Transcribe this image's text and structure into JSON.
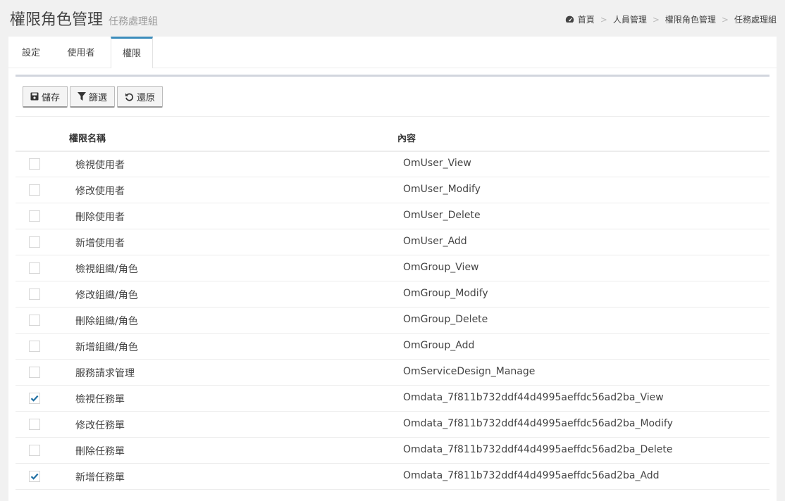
{
  "header": {
    "title": "權限角色管理",
    "subtitle": "任務處理組"
  },
  "breadcrumb": {
    "items": [
      "首頁",
      "人員管理",
      "權限角色管理",
      "任務處理組"
    ],
    "separator": ">",
    "home_icon": "dashboard-icon"
  },
  "tabs": [
    {
      "label": "設定"
    },
    {
      "label": "使用者"
    },
    {
      "label": "權限"
    }
  ],
  "active_tab": "權限",
  "toolbar": {
    "save_label": "儲存",
    "filter_label": "篩選",
    "reset_label": "還原"
  },
  "table": {
    "columns": {
      "name": "權限名稱",
      "content": "內容"
    },
    "rows": [
      {
        "name": "檢視使用者",
        "content": "OmUser_View",
        "checked": false
      },
      {
        "name": "修改使用者",
        "content": "OmUser_Modify",
        "checked": false
      },
      {
        "name": "刪除使用者",
        "content": "OmUser_Delete",
        "checked": false
      },
      {
        "name": "新增使用者",
        "content": "OmUser_Add",
        "checked": false
      },
      {
        "name": "檢視組織/角色",
        "content": "OmGroup_View",
        "checked": false
      },
      {
        "name": "修改組織/角色",
        "content": "OmGroup_Modify",
        "checked": false
      },
      {
        "name": "刪除組織/角色",
        "content": "OmGroup_Delete",
        "checked": false
      },
      {
        "name": "新增組織/角色",
        "content": "OmGroup_Add",
        "checked": false
      },
      {
        "name": "服務請求管理",
        "content": "OmServiceDesign_Manage",
        "checked": false
      },
      {
        "name": "檢視任務單",
        "content": "Omdata_7f811b732ddf44d4995aeffdc56ad2ba_View",
        "checked": true
      },
      {
        "name": "修改任務單",
        "content": "Omdata_7f811b732ddf44d4995aeffdc56ad2ba_Modify",
        "checked": false
      },
      {
        "name": "刪除任務單",
        "content": "Omdata_7f811b732ddf44d4995aeffdc56ad2ba_Delete",
        "checked": false
      },
      {
        "name": "新增任務單",
        "content": "Omdata_7f811b732ddf44d4995aeffdc56ad2ba_Add",
        "checked": true
      }
    ]
  },
  "colors": {
    "accent": "#3c8dbc",
    "check": "#1f6fa3"
  }
}
